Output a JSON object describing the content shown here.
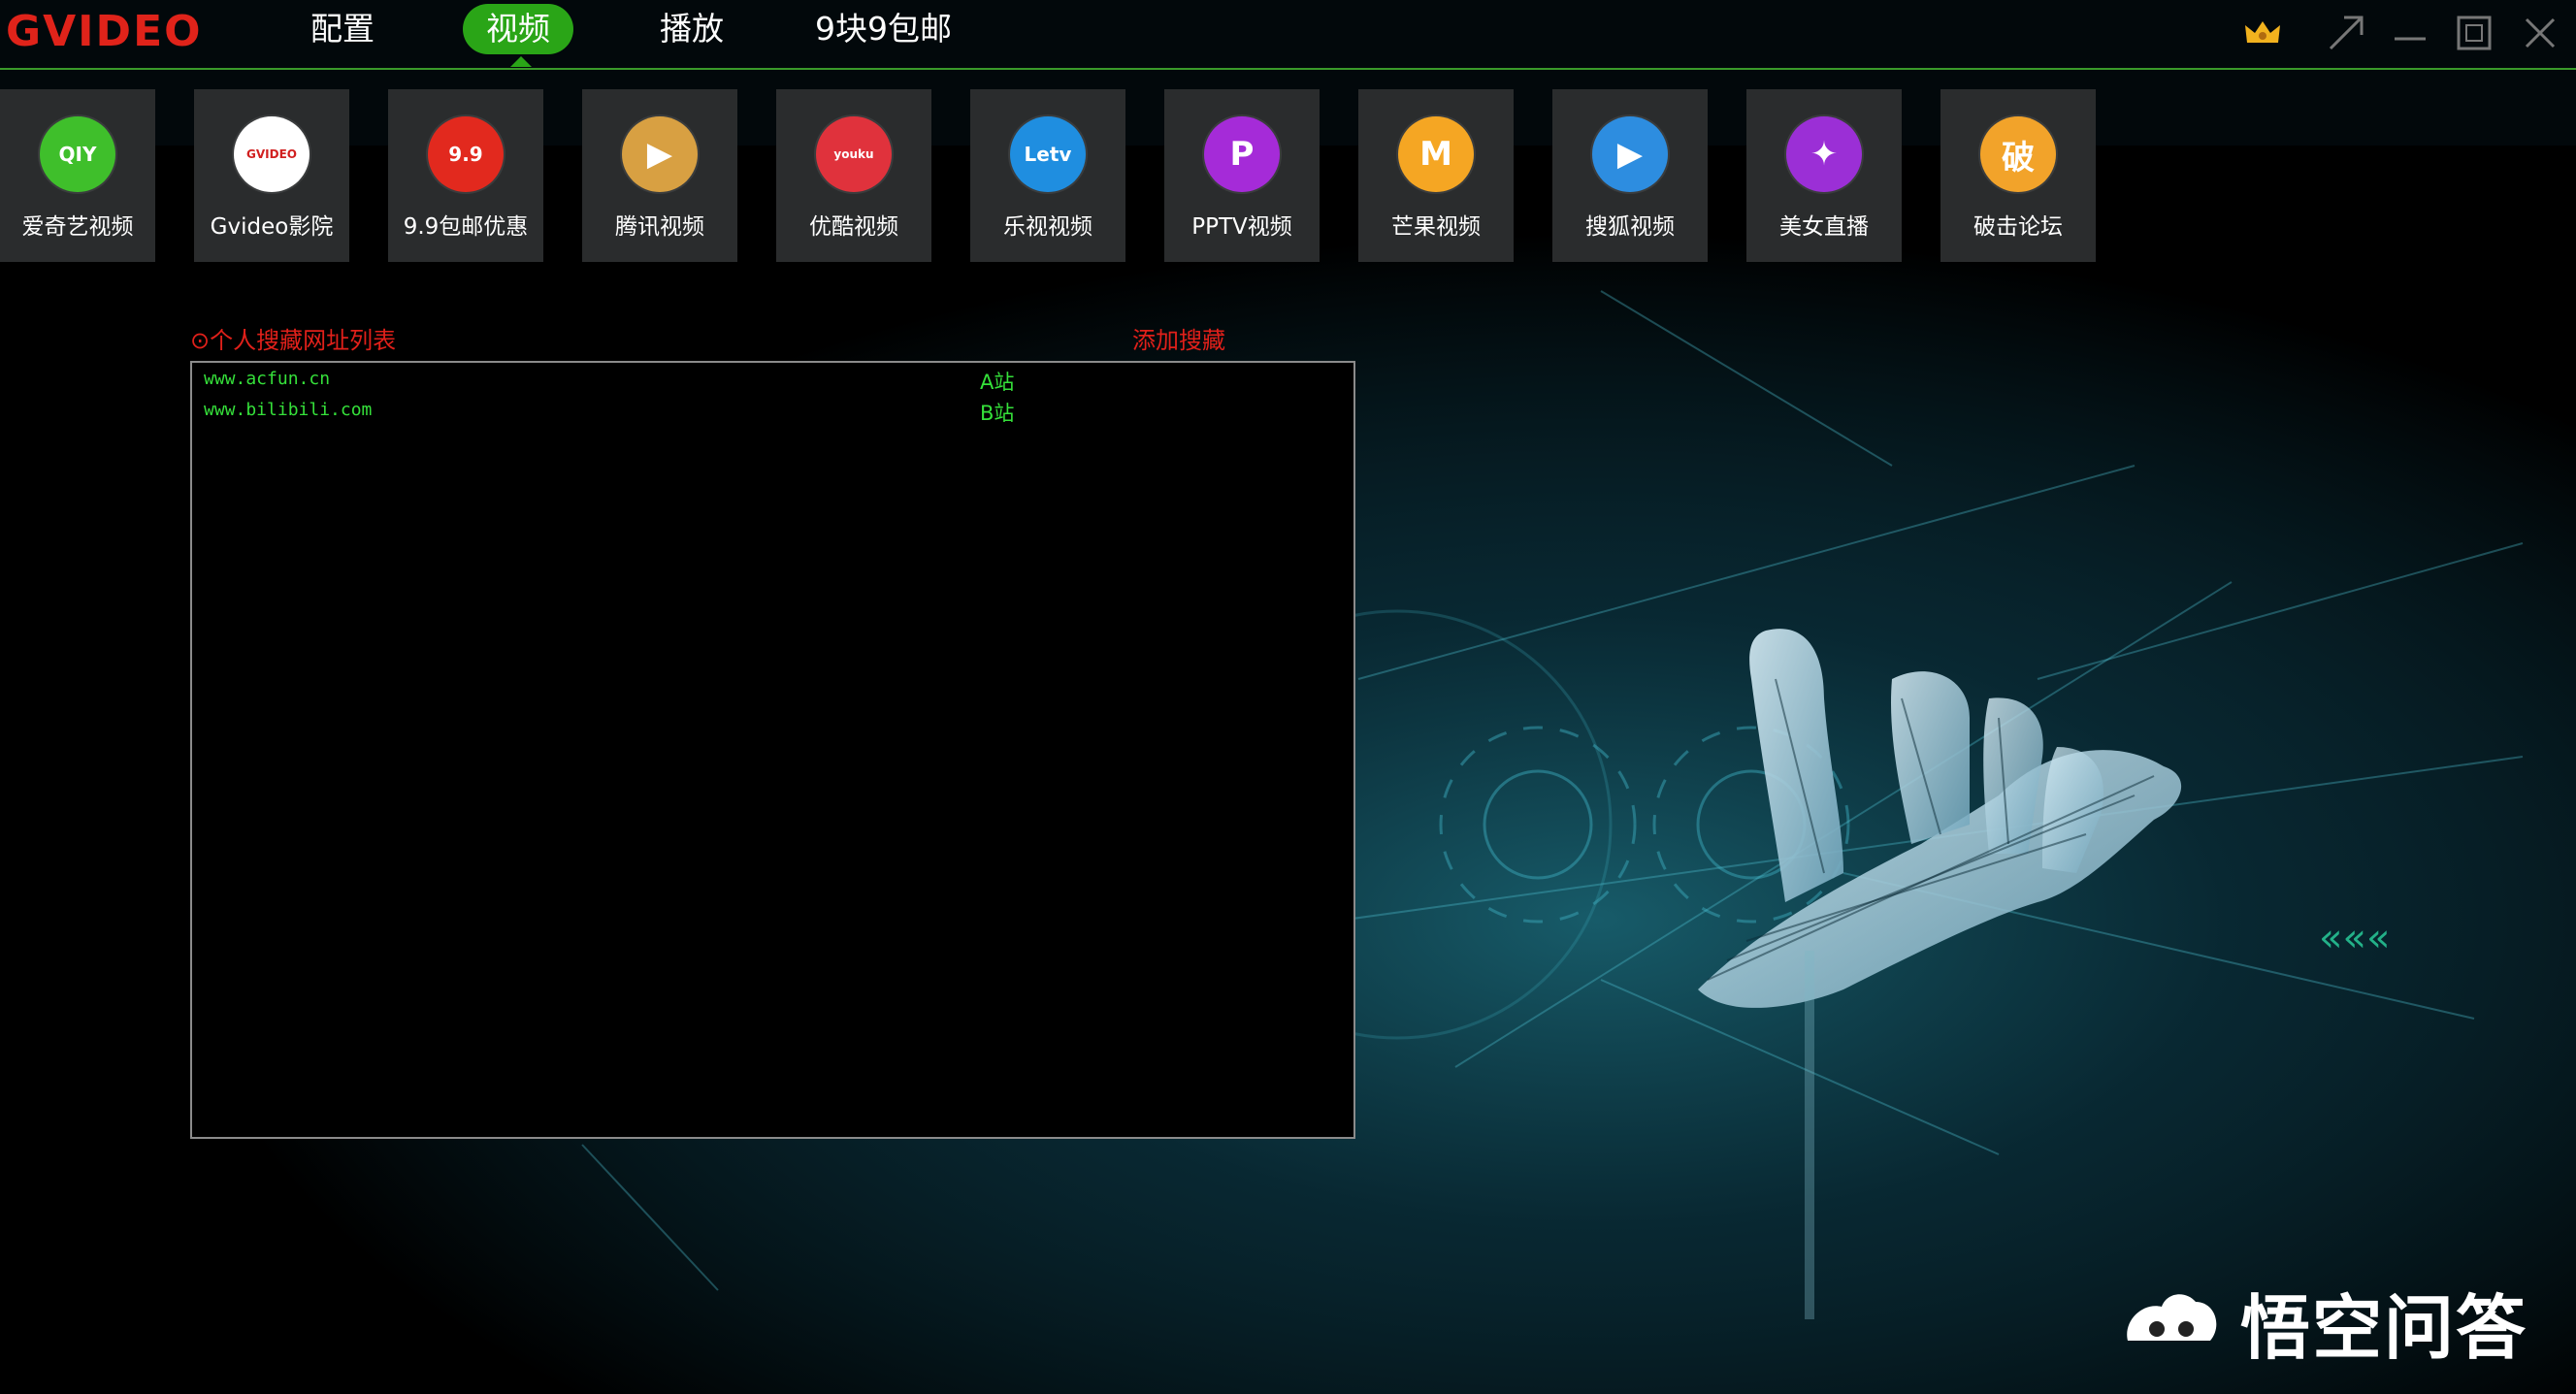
{
  "app": {
    "logo": "GVIDEO"
  },
  "nav": {
    "items": [
      "配置",
      "视频",
      "播放",
      "9块9包邮"
    ],
    "active": "视频"
  },
  "window_controls": [
    "crown-icon",
    "restore-arrow-icon",
    "minimize-icon",
    "maximize-icon",
    "close-icon"
  ],
  "tiles": [
    {
      "label": "爱奇艺视频",
      "icon": "iqiyi-icon",
      "color": "#3fbf2b",
      "glyph": "QIY"
    },
    {
      "label": "Gvideo影院",
      "icon": "gvideo-icon",
      "color": "#ffffff",
      "glyph": "GVIDEO"
    },
    {
      "label": "9.9包邮优惠",
      "icon": "baoyou-icon",
      "color": "#e2291e",
      "glyph": "9.9"
    },
    {
      "label": "腾讯视频",
      "icon": "tencent-video-icon",
      "color": "#d8a042",
      "glyph": "▶"
    },
    {
      "label": "优酷视频",
      "icon": "youku-icon",
      "color": "#e0323c",
      "glyph": "youku"
    },
    {
      "label": "乐视视频",
      "icon": "letv-icon",
      "color": "#1f8ee0",
      "glyph": "Letv"
    },
    {
      "label": "PPTV视频",
      "icon": "pptv-icon",
      "color": "#a52bd8",
      "glyph": "P"
    },
    {
      "label": "芒果视频",
      "icon": "mango-icon",
      "color": "#f5a623",
      "glyph": "M"
    },
    {
      "label": "搜狐视频",
      "icon": "sohu-icon",
      "color": "#2d8de0",
      "glyph": "▶"
    },
    {
      "label": "美女直播",
      "icon": "live-icon",
      "color": "#9b2fd6",
      "glyph": "✦"
    },
    {
      "label": "破击论坛",
      "icon": "forum-icon",
      "color": "#f2a32a",
      "glyph": "破"
    }
  ],
  "section": {
    "title": "⊙个人搜藏网址列表",
    "add_link": "添加搜藏"
  },
  "bookmarks": [
    {
      "url": "www.acfun.cn",
      "name": "A站"
    },
    {
      "url": "www.bilibili.com",
      "name": "B站"
    }
  ],
  "watermark": {
    "text": "悟空问答"
  },
  "colors": {
    "accent_green": "#2aa517",
    "logo_red": "#e0231a",
    "link_red": "#e0201a",
    "list_green": "#35e03a",
    "tile_bg": "#2a2c2d"
  }
}
